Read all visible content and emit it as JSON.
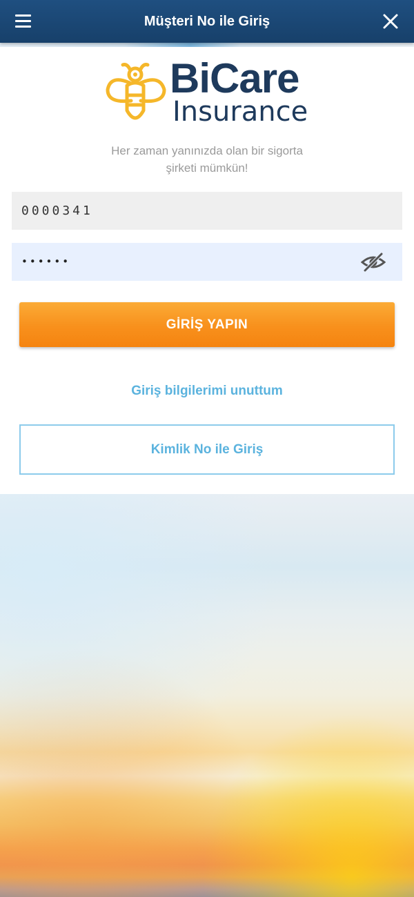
{
  "header": {
    "title": "Müşteri No ile Giriş",
    "menu_icon": "hamburger-menu-icon",
    "close_icon": "close-icon"
  },
  "brand": {
    "name_line1": "BiCare",
    "name_line2": "Insurance",
    "logo_icon": "bee-icon",
    "primary_color": "#1e3a5c",
    "accent_color": "#f5b72a"
  },
  "tagline": {
    "line1": "Her zaman yanınızda olan bir sigorta",
    "line2": "şirketi mümkün!"
  },
  "form": {
    "customer_no_value": "0000341",
    "password_value": "••••••",
    "password_toggle_icon": "eye-slash-icon"
  },
  "actions": {
    "login_label": "GİRİŞ YAPIN",
    "forgot_label": "Giriş bilgilerimi unuttum",
    "id_login_label": "Kimlik No ile Giriş"
  },
  "colors": {
    "header_bg": "#1b4675",
    "login_button": "#f8901c",
    "link": "#5bb3de"
  }
}
